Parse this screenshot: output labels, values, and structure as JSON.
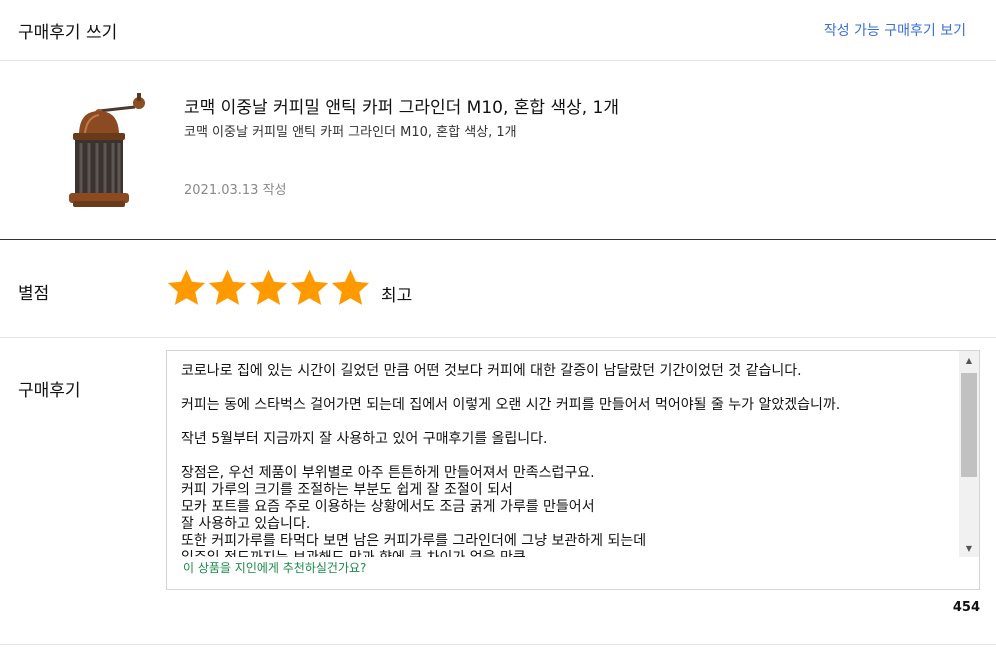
{
  "header": {
    "title": "구매후기 쓰기",
    "link_label": "작성 가능 구매후기 보기"
  },
  "product": {
    "title": "코맥 이중날 커피밀 앤틱 카퍼 그라인더 M10, 혼합 색상, 1개",
    "subtitle": "코맥 이중날 커피밀 앤틱 카퍼 그라인더 M10, 혼합 색상, 1개",
    "date": "2021.03.13 작성",
    "image_icon": "coffee-grinder"
  },
  "rating": {
    "label": "별점",
    "value": 5,
    "max": 5,
    "text": "최고",
    "star_color": "#ff9900"
  },
  "review": {
    "label": "구매후기",
    "lines": [
      "코로나로 집에 있는 시간이 길었던 만큼 어떤 것보다 커피에 대한 갈증이 남달랐던 기간이었던 것 같습니다.",
      "",
      "커피는 동에 스타벅스 걸어가면 되는데 집에서 이렇게 오랜 시간 커피를 만들어서 먹어야될 줄 누가 알았겠습니까.",
      "",
      "작년 5월부터 지금까지 잘 사용하고 있어 구매후기를 올립니다.",
      "",
      "장점은, 우선 제품이 부위별로 아주 튼튼하게 만들어져서 만족스럽구요.",
      "커피 가루의 크기를 조절하는 부분도 쉽게 잘 조절이 되서",
      "모카 포트를 요즘 주로 이용하는 상황에서도 조금 굵게 가루를 만들어서",
      "잘 사용하고 있습니다.",
      "또한 커피가루를 타먹다 보면 남은 커피가루를 그라인더에 그냥 보관하게 되는데",
      "일주일 정도까지는 보관해도 맛과 향에 큰 차이가 없을 만큼"
    ],
    "recommend_prompt": "이 상품을 지인에게 추천하실건가요?",
    "char_count": "454"
  }
}
